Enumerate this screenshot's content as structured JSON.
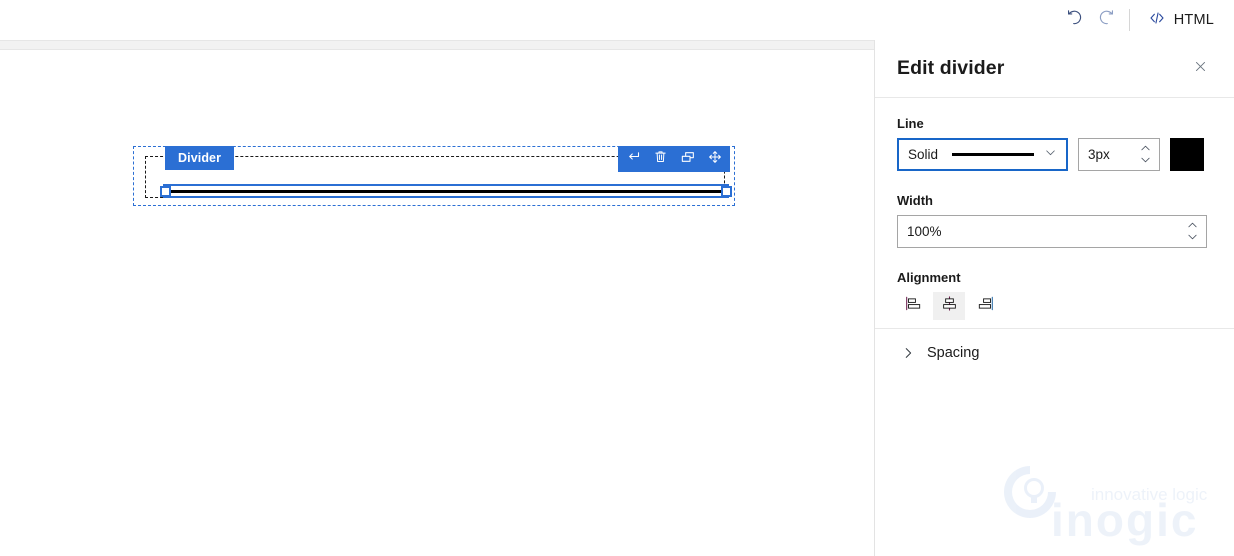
{
  "toolbar": {
    "undo_icon": "undo-icon",
    "redo_icon": "redo-icon",
    "html_label": "HTML",
    "html_icon": "code-icon"
  },
  "canvas": {
    "element": {
      "badge_label": "Divider",
      "line_color": "#000000",
      "line_thickness_px": 3,
      "selection_color": "#2b6fd4"
    },
    "element_toolbar": {
      "buttons": [
        {
          "name": "insert-after-button",
          "icon": "return-arrow-icon"
        },
        {
          "name": "delete-button",
          "icon": "trash-icon"
        },
        {
          "name": "duplicate-button",
          "icon": "duplicate-icon"
        },
        {
          "name": "move-button",
          "icon": "move-arrows-icon"
        }
      ]
    }
  },
  "panel": {
    "title": "Edit divider",
    "close_icon": "close-icon",
    "line": {
      "label": "Line",
      "style_value": "Solid",
      "style_chevron_icon": "chevron-down-icon",
      "thickness_value": "3px",
      "color_value": "#000000",
      "spinner_up_icon": "chevron-up-icon",
      "spinner_down_icon": "chevron-down-icon"
    },
    "width": {
      "label": "Width",
      "value": "100%",
      "spinner_up_icon": "chevron-up-icon",
      "spinner_down_icon": "chevron-down-icon"
    },
    "alignment": {
      "label": "Alignment",
      "options": [
        {
          "name": "align-left-button",
          "icon": "align-left-icon",
          "selected": false
        },
        {
          "name": "align-center-button",
          "icon": "align-center-icon",
          "selected": true
        },
        {
          "name": "align-right-button",
          "icon": "align-right-icon",
          "selected": false
        }
      ]
    },
    "spacing": {
      "label": "Spacing",
      "chevron_icon": "chevron-right-icon",
      "expanded": false
    }
  },
  "watermark": {
    "brand": "inogic",
    "tagline": "innovative logic",
    "color": "#e8eef8"
  }
}
